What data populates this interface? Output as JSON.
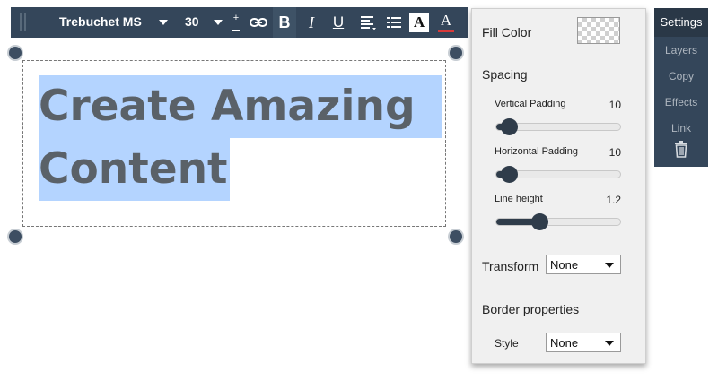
{
  "toolbar": {
    "font_family": "Trebuchet MS",
    "font_size": "30",
    "bold_label": "B",
    "italic_label": "I",
    "underline_label": "U",
    "text_bg_label": "A",
    "text_color_label": "A",
    "line_spacing_label": "+"
  },
  "canvas": {
    "headline_line1": "Create Amazing",
    "headline_line2": "Content"
  },
  "panel": {
    "fill_color_label": "Fill Color",
    "spacing_label": "Spacing",
    "sliders": [
      {
        "label": "Vertical Padding",
        "value": "10",
        "fraction": 0.1
      },
      {
        "label": "Horizontal Padding",
        "value": "10",
        "fraction": 0.1
      },
      {
        "label": "Line height",
        "value": "1.2",
        "fraction": 0.35
      }
    ],
    "transform_label": "Transform",
    "transform_value": "None",
    "border_label": "Border properties",
    "style_label": "Style",
    "style_value": "None"
  },
  "tabs": [
    "Settings",
    "Layers",
    "Copy",
    "Effects",
    "Link"
  ],
  "icons": {
    "delete": "trash-icon",
    "link": "link-icon",
    "list": "bullet-list-icon",
    "align": "align-left-icon"
  },
  "colors": {
    "toolbar_bg": "#34465a",
    "selection": "#b4d4ff",
    "text_color_underline": "#d83a3a"
  }
}
